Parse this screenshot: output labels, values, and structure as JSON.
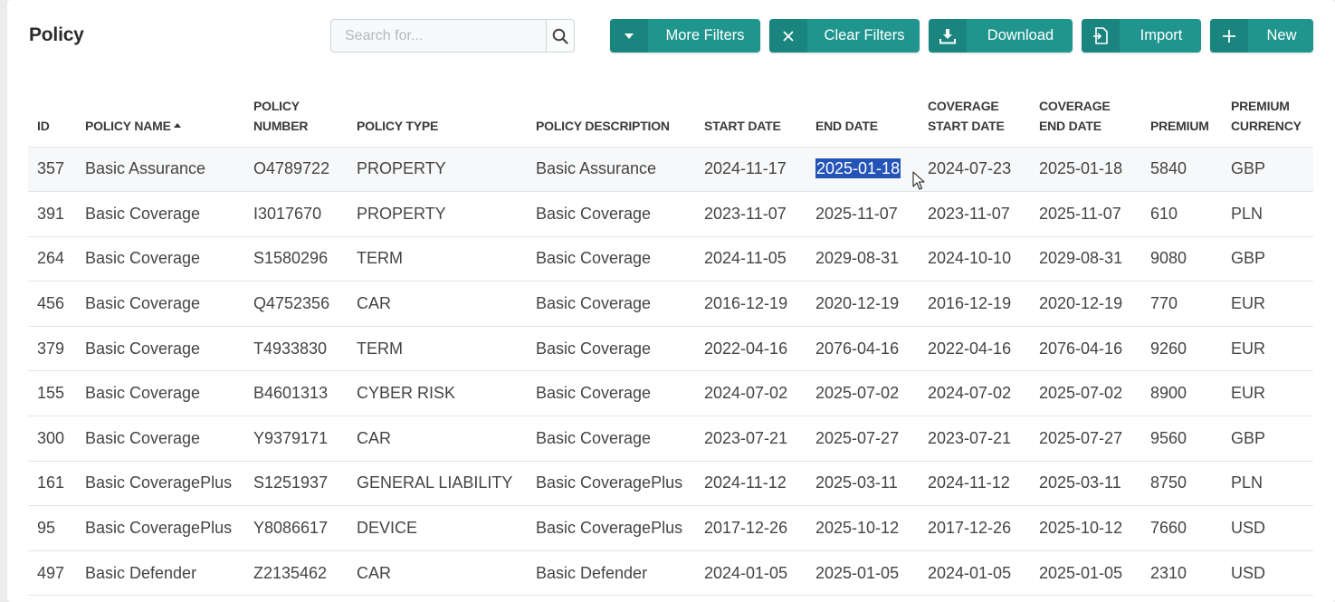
{
  "page": {
    "title": "Policy"
  },
  "search": {
    "placeholder": "Search for..."
  },
  "toolbar": {
    "more_filters": "More Filters",
    "clear_filters": "Clear Filters",
    "download": "Download",
    "import": "Import",
    "new": "New"
  },
  "colors": {
    "accent": "#1f958d",
    "selection": "#2554b8"
  },
  "table": {
    "columns": [
      {
        "key": "id",
        "lines": [
          "",
          "ID"
        ]
      },
      {
        "key": "policy_name",
        "lines": [
          "",
          "POLICY NAME"
        ],
        "sorted": "asc"
      },
      {
        "key": "policy_number",
        "lines": [
          "POLICY",
          "NUMBER"
        ]
      },
      {
        "key": "policy_type",
        "lines": [
          "",
          "POLICY TYPE"
        ]
      },
      {
        "key": "policy_description",
        "lines": [
          "",
          "POLICY DESCRIPTION"
        ]
      },
      {
        "key": "start_date",
        "lines": [
          "",
          "START DATE"
        ]
      },
      {
        "key": "end_date",
        "lines": [
          "",
          "END DATE"
        ]
      },
      {
        "key": "coverage_start_date",
        "lines": [
          "COVERAGE",
          "START DATE"
        ]
      },
      {
        "key": "coverage_end_date",
        "lines": [
          "COVERAGE",
          "END DATE"
        ]
      },
      {
        "key": "premium",
        "lines": [
          "",
          "PREMIUM"
        ]
      },
      {
        "key": "premium_currency",
        "lines": [
          "PREMIUM",
          "CURRENCY"
        ]
      }
    ],
    "rows": [
      [
        "357",
        "Basic Assurance",
        "O4789722",
        "PROPERTY",
        "Basic Assurance",
        "2024-11-17",
        "2025-01-18",
        "2024-07-23",
        "2025-01-18",
        "5840",
        "GBP"
      ],
      [
        "391",
        "Basic Coverage",
        "I3017670",
        "PROPERTY",
        "Basic Coverage",
        "2023-11-07",
        "2025-11-07",
        "2023-11-07",
        "2025-11-07",
        "610",
        "PLN"
      ],
      [
        "264",
        "Basic Coverage",
        "S1580296",
        "TERM",
        "Basic Coverage",
        "2024-11-05",
        "2029-08-31",
        "2024-10-10",
        "2029-08-31",
        "9080",
        "GBP"
      ],
      [
        "456",
        "Basic Coverage",
        "Q4752356",
        "CAR",
        "Basic Coverage",
        "2016-12-19",
        "2020-12-19",
        "2016-12-19",
        "2020-12-19",
        "770",
        "EUR"
      ],
      [
        "379",
        "Basic Coverage",
        "T4933830",
        "TERM",
        "Basic Coverage",
        "2022-04-16",
        "2076-04-16",
        "2022-04-16",
        "2076-04-16",
        "9260",
        "EUR"
      ],
      [
        "155",
        "Basic Coverage",
        "B4601313",
        "CYBER RISK",
        "Basic Coverage",
        "2024-07-02",
        "2025-07-02",
        "2024-07-02",
        "2025-07-02",
        "8900",
        "EUR"
      ],
      [
        "300",
        "Basic Coverage",
        "Y9379171",
        "CAR",
        "Basic Coverage",
        "2023-07-21",
        "2025-07-27",
        "2023-07-21",
        "2025-07-27",
        "9560",
        "GBP"
      ],
      [
        "161",
        "Basic CoveragePlus",
        "S1251937",
        "GENERAL LIABILITY",
        "Basic CoveragePlus",
        "2024-11-12",
        "2025-03-11",
        "2024-11-12",
        "2025-03-11",
        "8750",
        "PLN"
      ],
      [
        "95",
        "Basic CoveragePlus",
        "Y8086617",
        "DEVICE",
        "Basic CoveragePlus",
        "2017-12-26",
        "2025-10-12",
        "2017-12-26",
        "2025-10-12",
        "7660",
        "USD"
      ],
      [
        "497",
        "Basic Defender",
        "Z2135462",
        "CAR",
        "Basic Defender",
        "2024-01-05",
        "2025-01-05",
        "2024-01-05",
        "2025-01-05",
        "2310",
        "USD"
      ]
    ],
    "hovered_row": 0,
    "selected_cell": {
      "row": 0,
      "col": 6
    }
  }
}
